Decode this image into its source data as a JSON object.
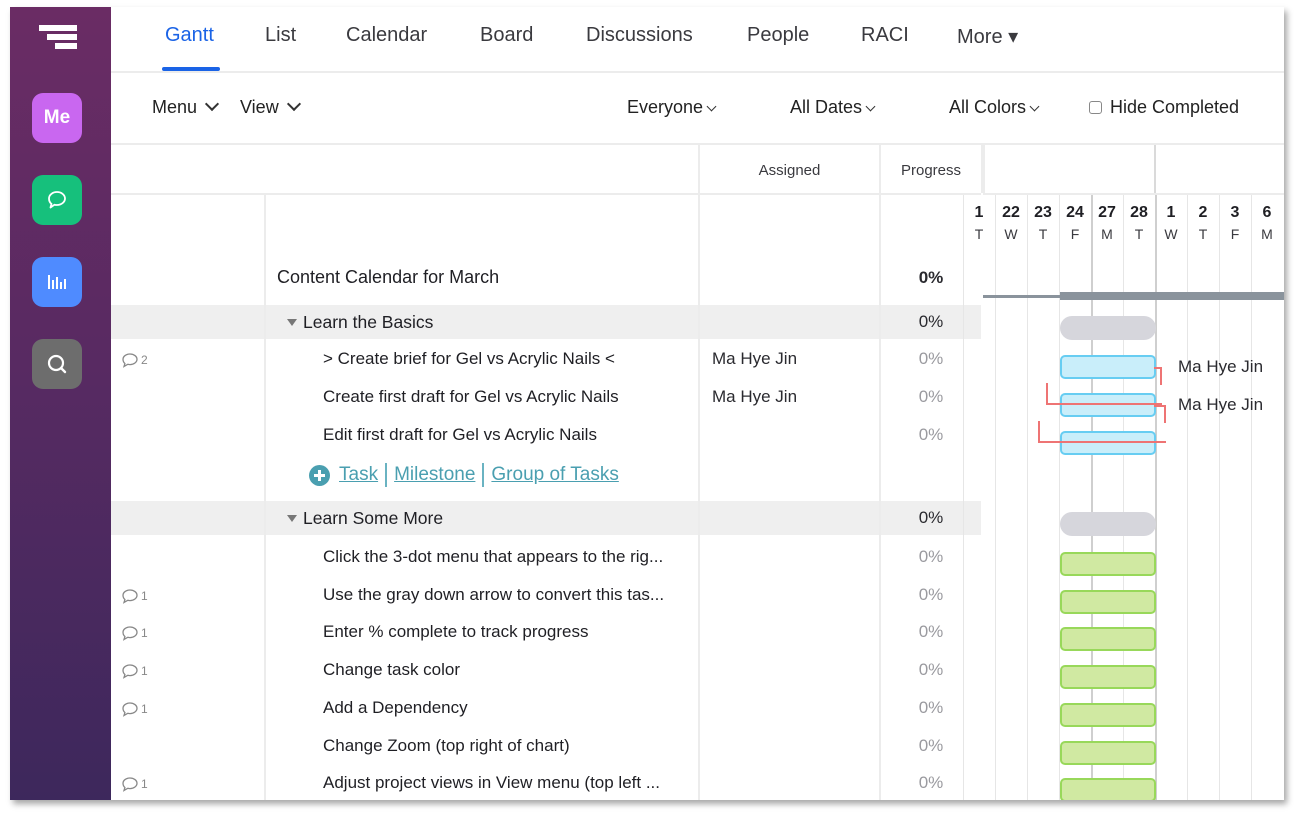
{
  "sidebar": {
    "items": [
      {
        "label": "Me",
        "icon": "me-icon",
        "color": "#c967f0"
      },
      {
        "label": "",
        "icon": "chat-icon",
        "color": "#16c07c"
      },
      {
        "label": "",
        "icon": "stats-icon",
        "color": "#4f8bff"
      },
      {
        "label": "",
        "icon": "search-icon",
        "color": "#6d6d6d"
      }
    ]
  },
  "tabs": [
    {
      "label": "Gantt",
      "active": true
    },
    {
      "label": "List"
    },
    {
      "label": "Calendar"
    },
    {
      "label": "Board"
    },
    {
      "label": "Discussions"
    },
    {
      "label": "People"
    },
    {
      "label": "RACI"
    },
    {
      "label": "More ▾"
    }
  ],
  "toolbar": {
    "menu": "Menu",
    "view": "View",
    "everyone": "Everyone",
    "all_dates": "All Dates",
    "all_colors": "All Colors",
    "hide_completed": "Hide Completed",
    "hide_completed_checked": false
  },
  "columns": {
    "assigned": "Assigned",
    "progress": "Progress"
  },
  "project": {
    "title": "Content Calendar for March",
    "progress": "0%"
  },
  "groups": [
    {
      "name": "Learn the Basics",
      "progress": "0%",
      "tasks": [
        {
          "name": "> Create brief for Gel vs Acrylic Nails <",
          "assigned": "Ma Hye Jin",
          "progress": "0%",
          "comments": "2"
        },
        {
          "name": "Create first draft for Gel vs Acrylic Nails",
          "assigned": "Ma Hye Jin",
          "progress": "0%",
          "comments": ""
        },
        {
          "name": "Edit first draft for Gel vs Acrylic Nails",
          "assigned": "",
          "progress": "0%",
          "comments": ""
        }
      ]
    },
    {
      "name": "Learn Some More",
      "progress": "0%",
      "tasks": [
        {
          "name": "Click the 3-dot menu that appears to the rig...",
          "assigned": "",
          "progress": "0%",
          "comments": ""
        },
        {
          "name": "Use the gray down arrow to convert this tas...",
          "assigned": "",
          "progress": "0%",
          "comments": "1"
        },
        {
          "name": "Enter % complete to track progress",
          "assigned": "",
          "progress": "0%",
          "comments": "1"
        },
        {
          "name": "Change task color",
          "assigned": "",
          "progress": "0%",
          "comments": "1"
        },
        {
          "name": "Add a Dependency",
          "assigned": "",
          "progress": "0%",
          "comments": "1"
        },
        {
          "name": "Change Zoom (top right of chart)",
          "assigned": "",
          "progress": "0%",
          "comments": ""
        },
        {
          "name": "Adjust project views in View menu (top left ...",
          "assigned": "",
          "progress": "0%",
          "comments": "1"
        }
      ]
    }
  ],
  "add_row": {
    "task": "Task",
    "milestone": "Milestone",
    "group": "Group of Tasks"
  },
  "timeline": {
    "days": [
      {
        "num": "1",
        "dow": "T"
      },
      {
        "num": "22",
        "dow": "W"
      },
      {
        "num": "23",
        "dow": "T"
      },
      {
        "num": "24",
        "dow": "F"
      },
      {
        "num": "27",
        "dow": "M"
      },
      {
        "num": "28",
        "dow": "T"
      },
      {
        "num": "1",
        "dow": "W"
      },
      {
        "num": "2",
        "dow": "T"
      },
      {
        "num": "3",
        "dow": "F"
      },
      {
        "num": "6",
        "dow": "M"
      }
    ],
    "week_starts": [
      4,
      6
    ],
    "bar_start_day_index": 3,
    "bar_end_day_index": 5,
    "bar_labels": [
      "Ma Hye Jin",
      "Ma Hye Jin"
    ],
    "colors": {
      "group_bar": "#d6d6dc",
      "blue_fill": "#c9eefa",
      "blue_border": "#67cdf2",
      "green_fill": "#d0e9a2",
      "green_border": "#98d85a",
      "dependency": "#ee7474",
      "summary": "#8a939c",
      "accent": "#1a63e6",
      "link": "#4a9fb0"
    }
  }
}
